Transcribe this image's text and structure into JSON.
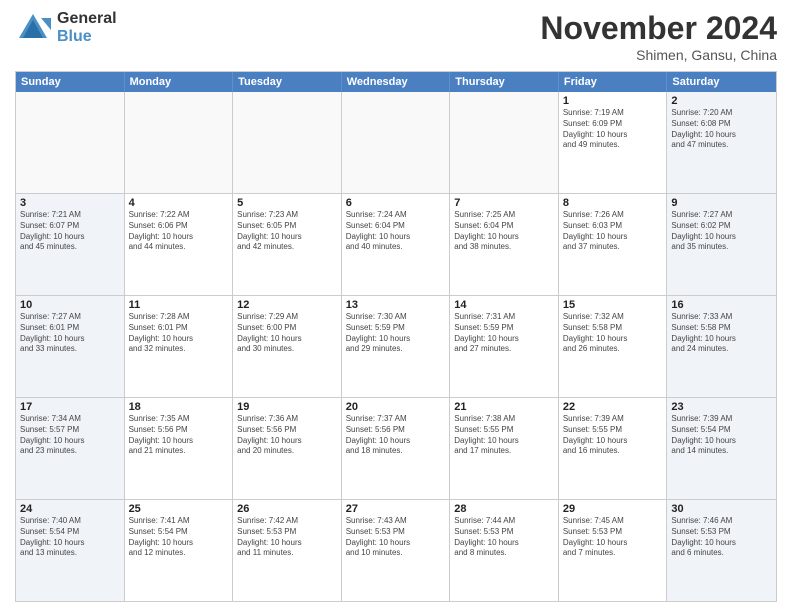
{
  "header": {
    "logo_general": "General",
    "logo_blue": "Blue",
    "month": "November 2024",
    "location": "Shimen, Gansu, China"
  },
  "weekdays": [
    "Sunday",
    "Monday",
    "Tuesday",
    "Wednesday",
    "Thursday",
    "Friday",
    "Saturday"
  ],
  "weeks": [
    [
      {
        "day": "",
        "info": ""
      },
      {
        "day": "",
        "info": ""
      },
      {
        "day": "",
        "info": ""
      },
      {
        "day": "",
        "info": ""
      },
      {
        "day": "",
        "info": ""
      },
      {
        "day": "1",
        "info": "Sunrise: 7:19 AM\nSunset: 6:09 PM\nDaylight: 10 hours\nand 49 minutes."
      },
      {
        "day": "2",
        "info": "Sunrise: 7:20 AM\nSunset: 6:08 PM\nDaylight: 10 hours\nand 47 minutes."
      }
    ],
    [
      {
        "day": "3",
        "info": "Sunrise: 7:21 AM\nSunset: 6:07 PM\nDaylight: 10 hours\nand 45 minutes."
      },
      {
        "day": "4",
        "info": "Sunrise: 7:22 AM\nSunset: 6:06 PM\nDaylight: 10 hours\nand 44 minutes."
      },
      {
        "day": "5",
        "info": "Sunrise: 7:23 AM\nSunset: 6:05 PM\nDaylight: 10 hours\nand 42 minutes."
      },
      {
        "day": "6",
        "info": "Sunrise: 7:24 AM\nSunset: 6:04 PM\nDaylight: 10 hours\nand 40 minutes."
      },
      {
        "day": "7",
        "info": "Sunrise: 7:25 AM\nSunset: 6:04 PM\nDaylight: 10 hours\nand 38 minutes."
      },
      {
        "day": "8",
        "info": "Sunrise: 7:26 AM\nSunset: 6:03 PM\nDaylight: 10 hours\nand 37 minutes."
      },
      {
        "day": "9",
        "info": "Sunrise: 7:27 AM\nSunset: 6:02 PM\nDaylight: 10 hours\nand 35 minutes."
      }
    ],
    [
      {
        "day": "10",
        "info": "Sunrise: 7:27 AM\nSunset: 6:01 PM\nDaylight: 10 hours\nand 33 minutes."
      },
      {
        "day": "11",
        "info": "Sunrise: 7:28 AM\nSunset: 6:01 PM\nDaylight: 10 hours\nand 32 minutes."
      },
      {
        "day": "12",
        "info": "Sunrise: 7:29 AM\nSunset: 6:00 PM\nDaylight: 10 hours\nand 30 minutes."
      },
      {
        "day": "13",
        "info": "Sunrise: 7:30 AM\nSunset: 5:59 PM\nDaylight: 10 hours\nand 29 minutes."
      },
      {
        "day": "14",
        "info": "Sunrise: 7:31 AM\nSunset: 5:59 PM\nDaylight: 10 hours\nand 27 minutes."
      },
      {
        "day": "15",
        "info": "Sunrise: 7:32 AM\nSunset: 5:58 PM\nDaylight: 10 hours\nand 26 minutes."
      },
      {
        "day": "16",
        "info": "Sunrise: 7:33 AM\nSunset: 5:58 PM\nDaylight: 10 hours\nand 24 minutes."
      }
    ],
    [
      {
        "day": "17",
        "info": "Sunrise: 7:34 AM\nSunset: 5:57 PM\nDaylight: 10 hours\nand 23 minutes."
      },
      {
        "day": "18",
        "info": "Sunrise: 7:35 AM\nSunset: 5:56 PM\nDaylight: 10 hours\nand 21 minutes."
      },
      {
        "day": "19",
        "info": "Sunrise: 7:36 AM\nSunset: 5:56 PM\nDaylight: 10 hours\nand 20 minutes."
      },
      {
        "day": "20",
        "info": "Sunrise: 7:37 AM\nSunset: 5:56 PM\nDaylight: 10 hours\nand 18 minutes."
      },
      {
        "day": "21",
        "info": "Sunrise: 7:38 AM\nSunset: 5:55 PM\nDaylight: 10 hours\nand 17 minutes."
      },
      {
        "day": "22",
        "info": "Sunrise: 7:39 AM\nSunset: 5:55 PM\nDaylight: 10 hours\nand 16 minutes."
      },
      {
        "day": "23",
        "info": "Sunrise: 7:39 AM\nSunset: 5:54 PM\nDaylight: 10 hours\nand 14 minutes."
      }
    ],
    [
      {
        "day": "24",
        "info": "Sunrise: 7:40 AM\nSunset: 5:54 PM\nDaylight: 10 hours\nand 13 minutes."
      },
      {
        "day": "25",
        "info": "Sunrise: 7:41 AM\nSunset: 5:54 PM\nDaylight: 10 hours\nand 12 minutes."
      },
      {
        "day": "26",
        "info": "Sunrise: 7:42 AM\nSunset: 5:53 PM\nDaylight: 10 hours\nand 11 minutes."
      },
      {
        "day": "27",
        "info": "Sunrise: 7:43 AM\nSunset: 5:53 PM\nDaylight: 10 hours\nand 10 minutes."
      },
      {
        "day": "28",
        "info": "Sunrise: 7:44 AM\nSunset: 5:53 PM\nDaylight: 10 hours\nand 8 minutes."
      },
      {
        "day": "29",
        "info": "Sunrise: 7:45 AM\nSunset: 5:53 PM\nDaylight: 10 hours\nand 7 minutes."
      },
      {
        "day": "30",
        "info": "Sunrise: 7:46 AM\nSunset: 5:53 PM\nDaylight: 10 hours\nand 6 minutes."
      }
    ]
  ]
}
